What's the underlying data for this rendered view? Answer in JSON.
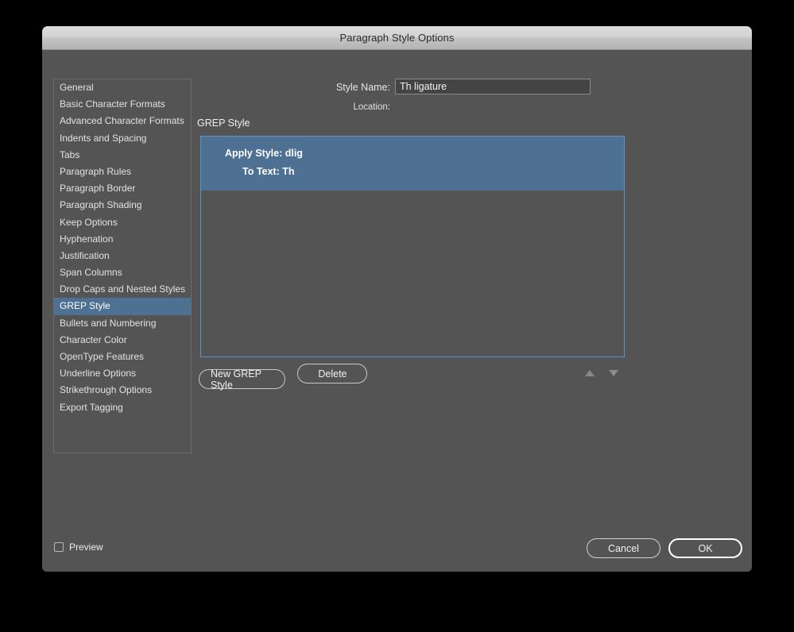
{
  "window": {
    "title": "Paragraph Style Options"
  },
  "sidebar": {
    "items": [
      {
        "label": "General",
        "selected": false
      },
      {
        "label": "Basic Character Formats",
        "selected": false
      },
      {
        "label": "Advanced Character Formats",
        "selected": false
      },
      {
        "label": "Indents and Spacing",
        "selected": false
      },
      {
        "label": "Tabs",
        "selected": false
      },
      {
        "label": "Paragraph Rules",
        "selected": false
      },
      {
        "label": "Paragraph Border",
        "selected": false
      },
      {
        "label": "Paragraph Shading",
        "selected": false
      },
      {
        "label": "Keep Options",
        "selected": false
      },
      {
        "label": "Hyphenation",
        "selected": false
      },
      {
        "label": "Justification",
        "selected": false
      },
      {
        "label": "Span Columns",
        "selected": false
      },
      {
        "label": "Drop Caps and Nested Styles",
        "selected": false
      },
      {
        "label": "GREP Style",
        "selected": true
      },
      {
        "label": "Bullets and Numbering",
        "selected": false
      },
      {
        "label": "Character Color",
        "selected": false
      },
      {
        "label": "OpenType Features",
        "selected": false
      },
      {
        "label": "Underline Options",
        "selected": false
      },
      {
        "label": "Strikethrough Options",
        "selected": false
      },
      {
        "label": "Export Tagging",
        "selected": false
      }
    ]
  },
  "header": {
    "style_name_label": "Style Name:",
    "style_name_value": "Th ligature",
    "location_label": "Location:",
    "location_value": ""
  },
  "grep_panel": {
    "section_title": "GREP Style",
    "entries": [
      {
        "apply_style": "Apply Style: dlig",
        "to_text": "To Text: Th",
        "selected": true
      }
    ],
    "new_button": "New GREP Style",
    "delete_button": "Delete",
    "move_up_icon": "triangle-up-icon",
    "move_down_icon": "triangle-down-icon"
  },
  "footer": {
    "preview_label": "Preview",
    "preview_checked": false,
    "cancel_label": "Cancel",
    "ok_label": "OK"
  },
  "colors": {
    "dialog_bg": "#545454",
    "titlebar_light": "#d2d2d2",
    "selection_blue": "#4e7093",
    "listbox_border_blue": "#5b93cc",
    "text_primary": "#ececec"
  }
}
